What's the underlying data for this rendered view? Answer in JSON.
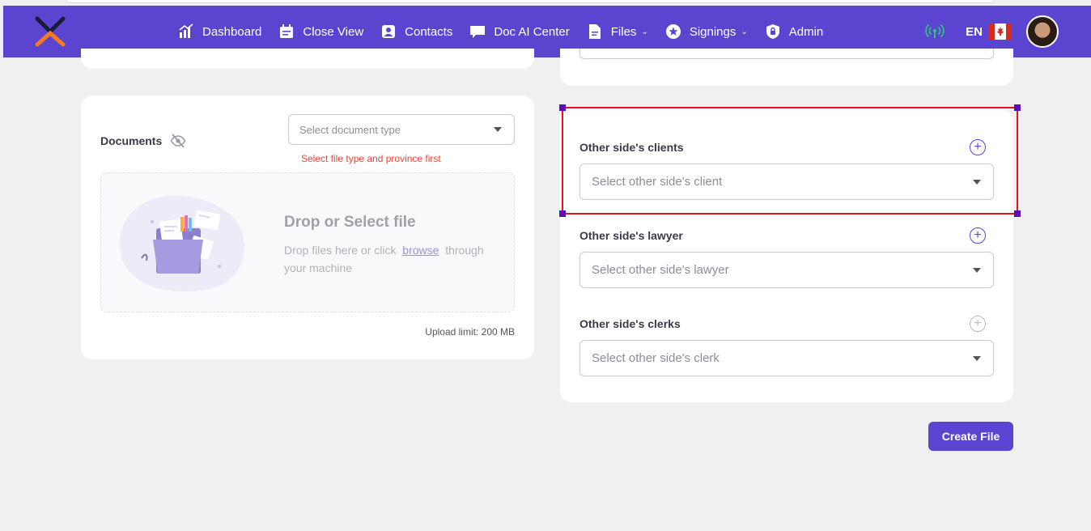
{
  "nav": {
    "items": [
      {
        "label": "Dashboard",
        "icon": "chart-icon"
      },
      {
        "label": "Close View",
        "icon": "calendar-icon"
      },
      {
        "label": "Contacts",
        "icon": "contact-icon"
      },
      {
        "label": "Doc AI Center",
        "icon": "chat-icon"
      },
      {
        "label": "Files",
        "icon": "file-icon",
        "dropdown": true
      },
      {
        "label": "Signings",
        "icon": "star-badge-icon",
        "dropdown": true
      },
      {
        "label": "Admin",
        "icon": "lock-icon"
      }
    ],
    "language": "EN",
    "colors": {
      "brand": "#5b45d0",
      "signal": "#2ec27e"
    }
  },
  "documents": {
    "title": "Documents",
    "select_placeholder": "Select document type",
    "error": "Select file type and province first",
    "dropzone_title": "Drop or Select file",
    "dropzone_text_before": "Drop files here or click",
    "dropzone_link": "browse",
    "dropzone_text_after": "through your machine",
    "upload_limit": "Upload limit: 200 MB"
  },
  "other_side": {
    "clients_label": "Other side's clients",
    "clients_placeholder": "Select other side's client",
    "lawyer_label": "Other side's lawyer",
    "lawyer_placeholder": "Select other side's lawyer",
    "clerks_label": "Other side's clerks",
    "clerks_placeholder": "Select other side's clerk"
  },
  "actions": {
    "create_label": "Create File"
  }
}
